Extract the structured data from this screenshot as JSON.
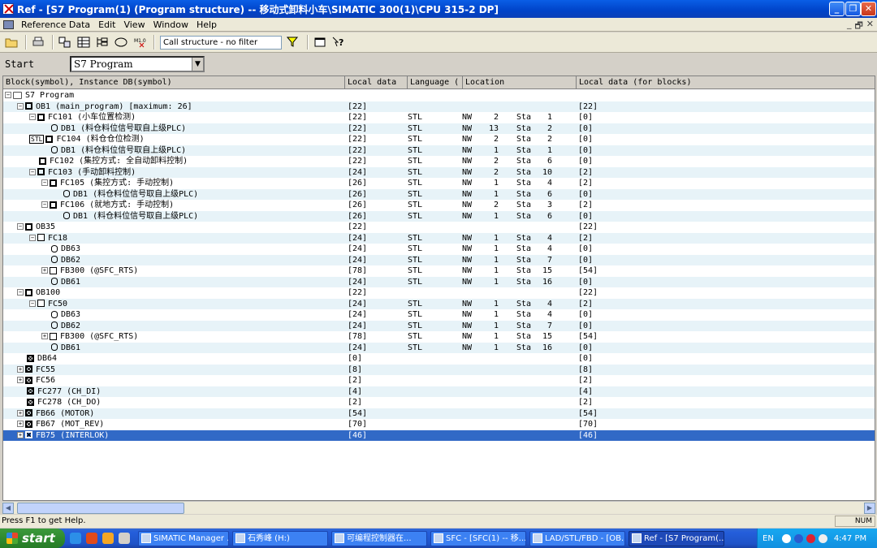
{
  "window": {
    "title": "Ref - [S7 Program(1) (Program structure) -- 移动式卸料小车\\SIMATIC 300(1)\\CPU 315-2 DP]",
    "minimize": "_",
    "restore": "❐",
    "close": "✕"
  },
  "menu": {
    "items": [
      "Reference Data",
      "Edit",
      "View",
      "Window",
      "Help"
    ],
    "min": "_",
    "restore": "🗗",
    "close": "✕"
  },
  "toolbar": {
    "filter_text": "Call structure - no filter"
  },
  "start": {
    "label": "Start",
    "value": "S7 Program"
  },
  "columns": [
    "Block(symbol), Instance DB(symbol)",
    "Local data",
    "Language (",
    "Location",
    "Local data (for blocks)"
  ],
  "rows": [
    {
      "tog": "−",
      "icon": "fold",
      "name": "S7 Program",
      "ld": "",
      "lang": "",
      "nw": "",
      "n": "",
      "sta": "",
      "s": "",
      "ldb": "",
      "indent": 0
    },
    {
      "tog": "−",
      "icon": "blk",
      "name": "OB1 (main_program) [maximum: 26]",
      "ld": "[22]",
      "lang": "",
      "nw": "",
      "n": "",
      "sta": "",
      "s": "",
      "ldb": "[22]",
      "indent": 1
    },
    {
      "tog": "−",
      "icon": "blk",
      "name": "FC101 (小车位置检测)",
      "ld": "[22]",
      "lang": "STL",
      "nw": "NW",
      "n": "2",
      "sta": "Sta",
      "s": "1",
      "ldb": "[0]",
      "indent": 2
    },
    {
      "tog": "",
      "icon": "db",
      "name": "DB1 (料仓料位信号取自上级PLC)",
      "ld": "[22]",
      "lang": "STL",
      "nw": "NW",
      "n": "13",
      "sta": "Sta",
      "s": "2",
      "ldb": "[0]",
      "indent": 3
    },
    {
      "tog": "stl",
      "icon": "blk",
      "name": "FC104 (料仓仓位检测)",
      "ld": "[22]",
      "lang": "STL",
      "nw": "NW",
      "n": "2",
      "sta": "Sta",
      "s": "2",
      "ldb": "[0]",
      "indent": 2
    },
    {
      "tog": "",
      "icon": "db",
      "name": "DB1 (料仓料位信号取自上级PLC)",
      "ld": "[22]",
      "lang": "STL",
      "nw": "NW",
      "n": "1",
      "sta": "Sta",
      "s": "1",
      "ldb": "[0]",
      "indent": 3
    },
    {
      "tog": "",
      "icon": "blk",
      "name": "FC102 (集控方式: 全自动卸料控制)",
      "ld": "[22]",
      "lang": "STL",
      "nw": "NW",
      "n": "2",
      "sta": "Sta",
      "s": "6",
      "ldb": "[0]",
      "indent": 2
    },
    {
      "tog": "−",
      "icon": "blk",
      "name": "FC103 (手动卸料控制)",
      "ld": "[24]",
      "lang": "STL",
      "nw": "NW",
      "n": "2",
      "sta": "Sta",
      "s": "10",
      "ldb": "[2]",
      "indent": 2
    },
    {
      "tog": "−",
      "icon": "blk",
      "name": "FC105 (集控方式: 手动控制)",
      "ld": "[26]",
      "lang": "STL",
      "nw": "NW",
      "n": "1",
      "sta": "Sta",
      "s": "4",
      "ldb": "[2]",
      "indent": 3
    },
    {
      "tog": "",
      "icon": "db",
      "name": "DB1 (料仓料位信号取自上级PLC)",
      "ld": "[26]",
      "lang": "STL",
      "nw": "NW",
      "n": "1",
      "sta": "Sta",
      "s": "6",
      "ldb": "[0]",
      "indent": 4
    },
    {
      "tog": "−",
      "icon": "blk",
      "name": "FC106 (就地方式: 手动控制)",
      "ld": "[26]",
      "lang": "STL",
      "nw": "NW",
      "n": "2",
      "sta": "Sta",
      "s": "3",
      "ldb": "[2]",
      "indent": 3
    },
    {
      "tog": "",
      "icon": "db",
      "name": "DB1 (料仓料位信号取自上级PLC)",
      "ld": "[26]",
      "lang": "STL",
      "nw": "NW",
      "n": "1",
      "sta": "Sta",
      "s": "6",
      "ldb": "[0]",
      "indent": 4
    },
    {
      "tog": "−",
      "icon": "blk",
      "name": "OB35",
      "ld": "[22]",
      "lang": "",
      "nw": "",
      "n": "",
      "sta": "",
      "s": "",
      "ldb": "[22]",
      "indent": 1
    },
    {
      "tog": "−",
      "icon": "fb",
      "name": "FC18",
      "ld": "[24]",
      "lang": "STL",
      "nw": "NW",
      "n": "1",
      "sta": "Sta",
      "s": "4",
      "ldb": "[2]",
      "indent": 2
    },
    {
      "tog": "",
      "icon": "db",
      "name": "DB63",
      "ld": "[24]",
      "lang": "STL",
      "nw": "NW",
      "n": "1",
      "sta": "Sta",
      "s": "4",
      "ldb": "[0]",
      "indent": 3
    },
    {
      "tog": "",
      "icon": "db",
      "name": "DB62",
      "ld": "[24]",
      "lang": "STL",
      "nw": "NW",
      "n": "1",
      "sta": "Sta",
      "s": "7",
      "ldb": "[0]",
      "indent": 3
    },
    {
      "tog": "+",
      "icon": "fb",
      "name": "FB300 (@SFC_RTS)",
      "ld": "[78]",
      "lang": "STL",
      "nw": "NW",
      "n": "1",
      "sta": "Sta",
      "s": "15",
      "ldb": "[54]",
      "indent": 3
    },
    {
      "tog": "",
      "icon": "db",
      "name": "DB61",
      "ld": "[24]",
      "lang": "STL",
      "nw": "NW",
      "n": "1",
      "sta": "Sta",
      "s": "16",
      "ldb": "[0]",
      "indent": 3
    },
    {
      "tog": "−",
      "icon": "blk",
      "name": "OB100",
      "ld": "[22]",
      "lang": "",
      "nw": "",
      "n": "",
      "sta": "",
      "s": "",
      "ldb": "[22]",
      "indent": 1
    },
    {
      "tog": "−",
      "icon": "fb",
      "name": "FC50",
      "ld": "[24]",
      "lang": "STL",
      "nw": "NW",
      "n": "1",
      "sta": "Sta",
      "s": "4",
      "ldb": "[2]",
      "indent": 2
    },
    {
      "tog": "",
      "icon": "db",
      "name": "DB63",
      "ld": "[24]",
      "lang": "STL",
      "nw": "NW",
      "n": "1",
      "sta": "Sta",
      "s": "4",
      "ldb": "[0]",
      "indent": 3
    },
    {
      "tog": "",
      "icon": "db",
      "name": "DB62",
      "ld": "[24]",
      "lang": "STL",
      "nw": "NW",
      "n": "1",
      "sta": "Sta",
      "s": "7",
      "ldb": "[0]",
      "indent": 3
    },
    {
      "tog": "+",
      "icon": "fb",
      "name": "FB300 (@SFC_RTS)",
      "ld": "[78]",
      "lang": "STL",
      "nw": "NW",
      "n": "1",
      "sta": "Sta",
      "s": "15",
      "ldb": "[54]",
      "indent": 3
    },
    {
      "tog": "",
      "icon": "db",
      "name": "DB61",
      "ld": "[24]",
      "lang": "STL",
      "nw": "NW",
      "n": "1",
      "sta": "Sta",
      "s": "16",
      "ldb": "[0]",
      "indent": 3
    },
    {
      "tog": "",
      "icon": "xo",
      "name": "DB64",
      "ld": "[0]",
      "lang": "",
      "nw": "",
      "n": "",
      "sta": "",
      "s": "",
      "ldb": "[0]",
      "indent": 1
    },
    {
      "tog": "+",
      "icon": "xo",
      "name": "FC55",
      "ld": "[8]",
      "lang": "",
      "nw": "",
      "n": "",
      "sta": "",
      "s": "",
      "ldb": "[8]",
      "indent": 1
    },
    {
      "tog": "+",
      "icon": "xo",
      "name": "FC56",
      "ld": "[2]",
      "lang": "",
      "nw": "",
      "n": "",
      "sta": "",
      "s": "",
      "ldb": "[2]",
      "indent": 1
    },
    {
      "tog": "",
      "icon": "xo",
      "name": "FC277 (CH_DI)",
      "ld": "[4]",
      "lang": "",
      "nw": "",
      "n": "",
      "sta": "",
      "s": "",
      "ldb": "[4]",
      "indent": 1
    },
    {
      "tog": "",
      "icon": "xo",
      "name": "FC278 (CH_DO)",
      "ld": "[2]",
      "lang": "",
      "nw": "",
      "n": "",
      "sta": "",
      "s": "",
      "ldb": "[2]",
      "indent": 1
    },
    {
      "tog": "+",
      "icon": "xo",
      "name": "FB66 (MOTOR)",
      "ld": "[54]",
      "lang": "",
      "nw": "",
      "n": "",
      "sta": "",
      "s": "",
      "ldb": "[54]",
      "indent": 1
    },
    {
      "tog": "+",
      "icon": "xo",
      "name": "FB67 (MOT_REV)",
      "ld": "[70]",
      "lang": "",
      "nw": "",
      "n": "",
      "sta": "",
      "s": "",
      "ldb": "[70]",
      "indent": 1
    },
    {
      "tog": "+",
      "icon": "xo",
      "name": "FB75 (INTERLOK)",
      "ld": "[46]",
      "lang": "",
      "nw": "",
      "n": "",
      "sta": "",
      "s": "",
      "ldb": "[46]",
      "indent": 1,
      "selected": true
    }
  ],
  "status": {
    "help": "Press F1 to get Help.",
    "num": "NUM"
  },
  "taskbar": {
    "start": "start",
    "tasks": [
      "SIMATIC Manager ...",
      "石秀峰 (H:)",
      "可编程控制器在...",
      "SFC - [SFC(1) -- 移...",
      "LAD/STL/FBD - [OB...",
      "Ref - [S7 Program(..."
    ],
    "lang": "EN",
    "time": "4:47 PM"
  }
}
